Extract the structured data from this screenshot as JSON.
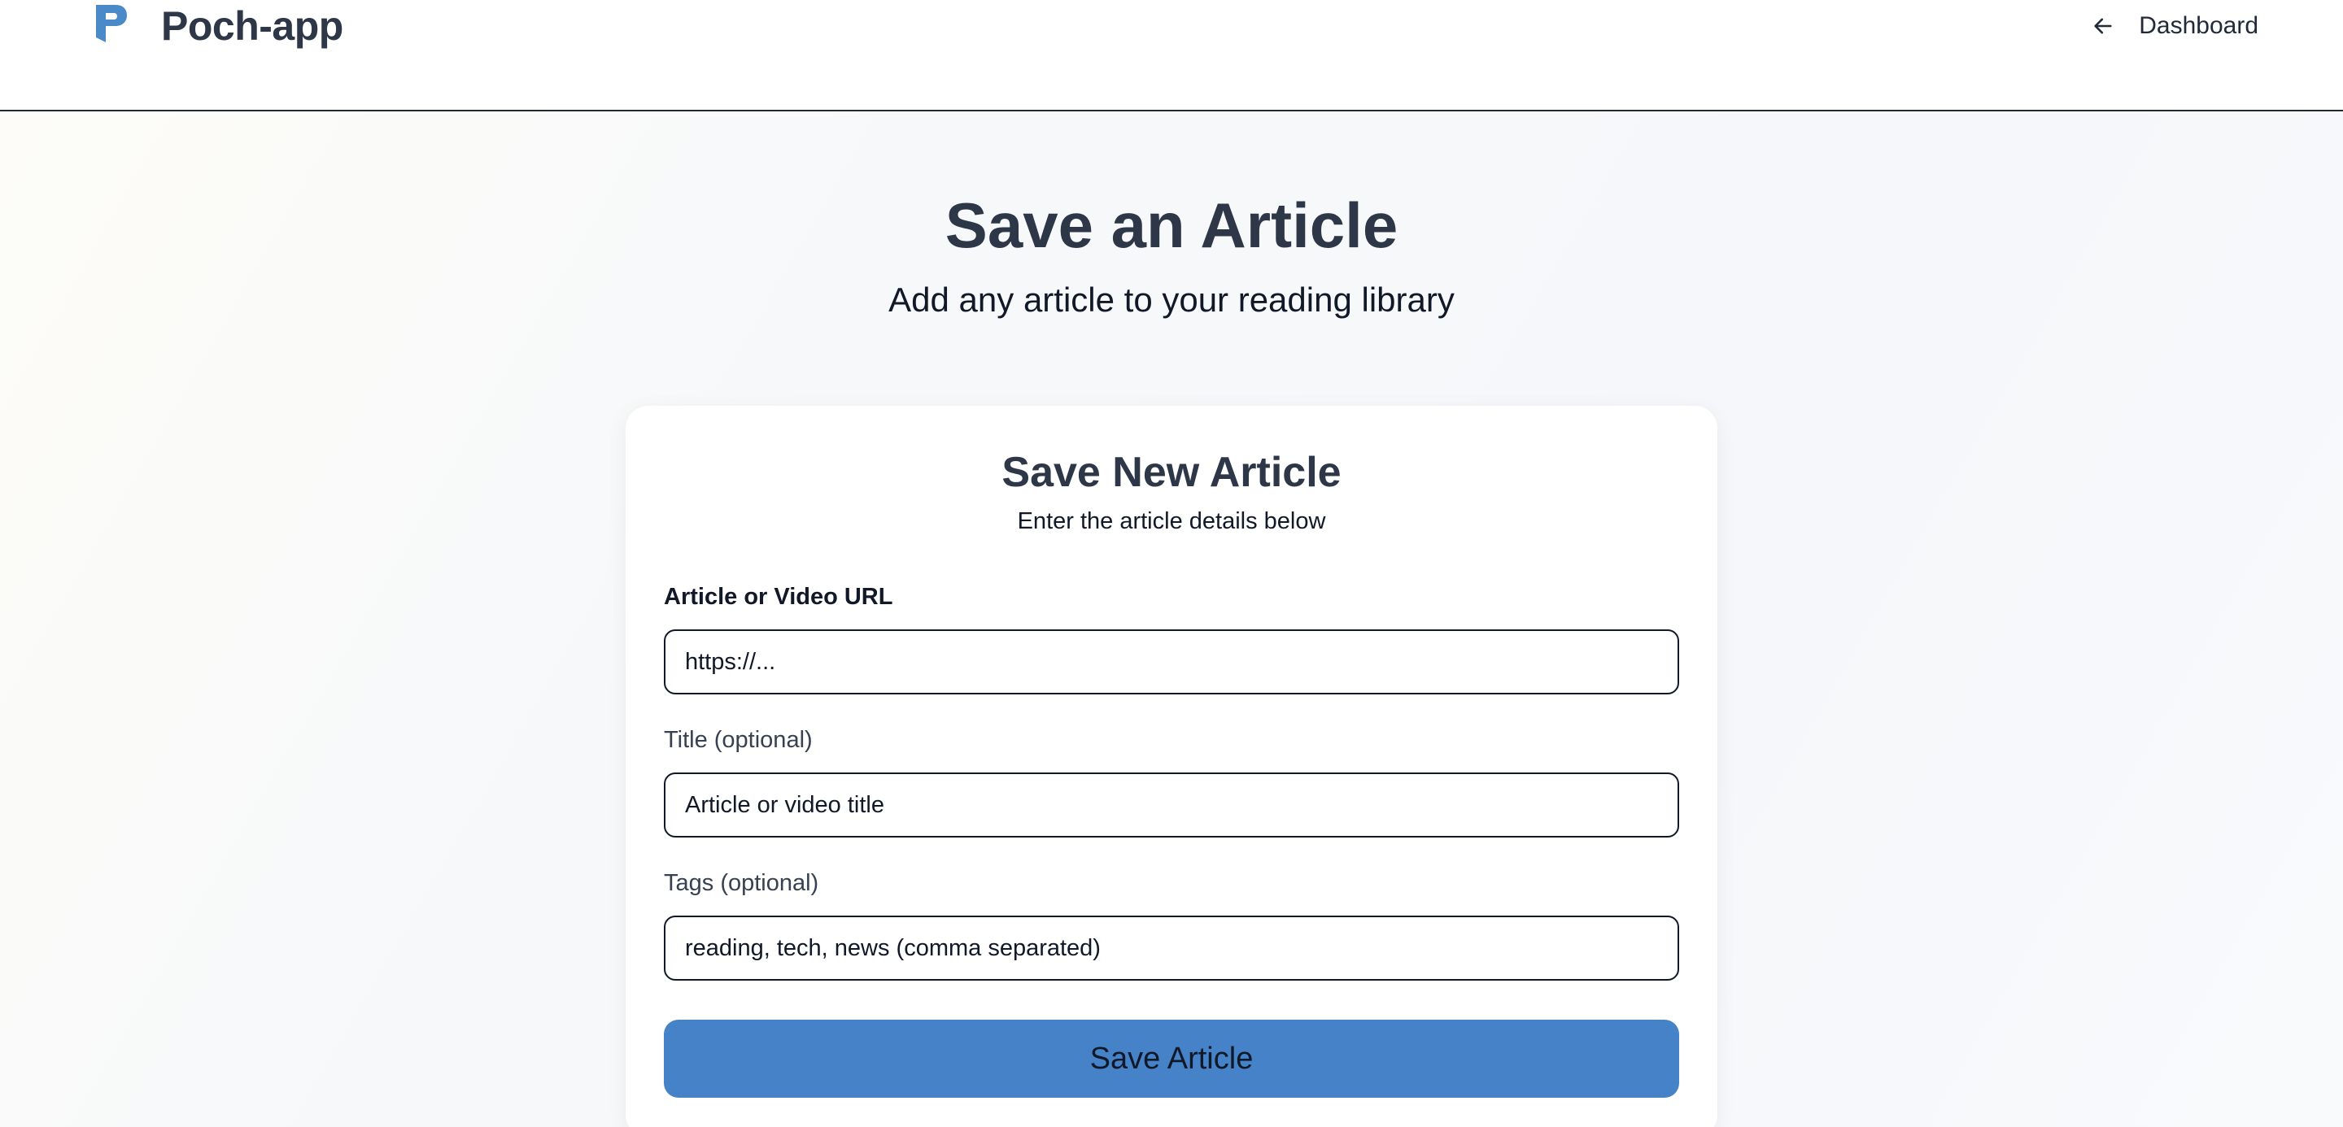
{
  "header": {
    "brand": "Poch-app",
    "dashboard_link": "Dashboard"
  },
  "hero": {
    "title": "Save an Article",
    "subtitle": "Add any article to your reading library"
  },
  "form": {
    "title": "Save New Article",
    "subtitle": "Enter the article details below",
    "url_label": "Article or Video URL",
    "url_placeholder": "https://...",
    "title_label": "Title (optional)",
    "title_placeholder": "Article or video title",
    "tags_label": "Tags (optional)",
    "tags_placeholder": "reading, tech, news (comma separated)",
    "submit_label": "Save Article"
  },
  "icons": {
    "logo": "poch-logo-icon",
    "back": "arrow-left-icon"
  },
  "colors": {
    "primary": "#4682c8",
    "logo": "#4a8ac9",
    "heading": "#2d3748"
  }
}
